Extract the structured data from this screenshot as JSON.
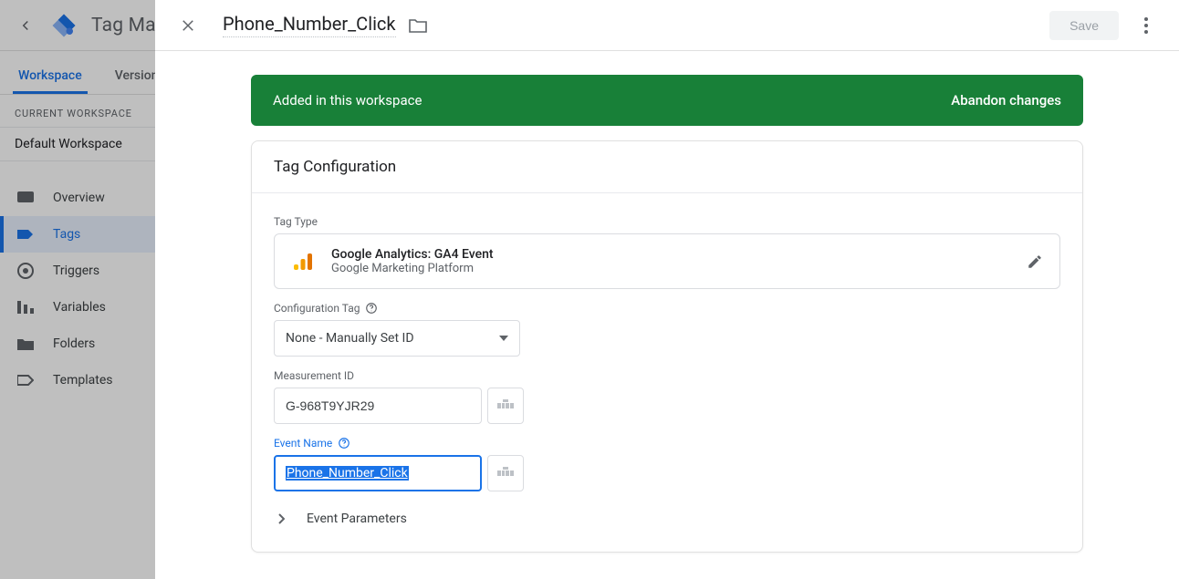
{
  "bg": {
    "title": "Tag Mana",
    "tabs": {
      "workspace": "Workspace",
      "versions": "Version"
    },
    "current_label": "CURRENT WORKSPACE",
    "workspace": "Default Workspace",
    "nav": {
      "overview": "Overview",
      "tags": "Tags",
      "triggers": "Triggers",
      "variables": "Variables",
      "folders": "Folders",
      "templates": "Templates"
    }
  },
  "panel": {
    "title": "Phone_Number_Click",
    "save": "Save"
  },
  "banner": {
    "msg": "Added in this workspace",
    "action": "Abandon changes"
  },
  "card": {
    "title": "Tag Configuration",
    "tagtype_label": "Tag Type",
    "tagtype_name": "Google Analytics: GA4 Event",
    "tagtype_sub": "Google Marketing Platform",
    "config_label": "Configuration Tag",
    "config_value": "None - Manually Set ID",
    "measurement_label": "Measurement ID",
    "measurement_value": "G-968T9YJR29",
    "event_label": "Event Name",
    "event_value": "Phone_Number_Click",
    "params_label": "Event Parameters"
  }
}
